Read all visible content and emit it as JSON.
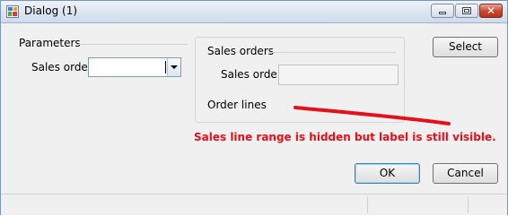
{
  "window": {
    "title": "Dialog (1)",
    "close_glyph": "✕"
  },
  "parameters_group": {
    "title": "Parameters",
    "sales_order_label": "Sales order:",
    "sales_order_value": ""
  },
  "sales_orders_group": {
    "title": "Sales orders",
    "sales_order_label": "Sales order:",
    "sales_order_value": "",
    "order_lines_label": "Order lines"
  },
  "buttons": {
    "select_label": "Select",
    "ok_label": "OK",
    "cancel_label": "Cancel"
  },
  "annotation": {
    "text": "Sales line range is hidden but label is still visible.",
    "color": "#e4101a"
  },
  "icons": {
    "app": "app-icon",
    "minimize": "minimize-icon",
    "maximize": "maximize-icon",
    "close": "close-icon",
    "dropdown": "chevron-down-icon"
  }
}
